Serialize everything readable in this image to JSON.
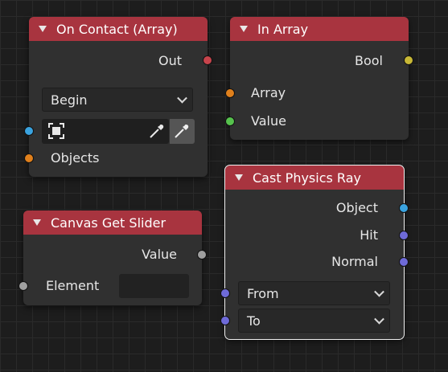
{
  "nodes": {
    "on_contact": {
      "title": "On Contact (Array)",
      "out_label": "Out",
      "mode_value": "Begin",
      "objects_label": "Objects"
    },
    "in_array": {
      "title": "In Array",
      "bool_label": "Bool",
      "array_label": "Array",
      "value_label": "Value"
    },
    "canvas_get_slider": {
      "title": "Canvas Get Slider",
      "value_label": "Value",
      "element_label": "Element",
      "element_value": ""
    },
    "cast_physics_ray": {
      "title": "Cast Physics Ray",
      "object_label": "Object",
      "hit_label": "Hit",
      "normal_label": "Normal",
      "from_value": "From",
      "to_value": "To"
    }
  },
  "colors": {
    "header": "#a8343f",
    "node_body": "#303030",
    "background": "#1d1d1d",
    "socket_exec": "#c7444c",
    "socket_bool": "#c8b836",
    "socket_array": "#e0801c",
    "socket_value": "#56c24d",
    "socket_object": "#3aa3df",
    "socket_vector": "#6e6ad8",
    "socket_generic": "#a0a0a0"
  },
  "icons": [
    "collapse-triangle-icon",
    "object-select-icon",
    "eyedropper-icon",
    "chevron-down-icon"
  ]
}
